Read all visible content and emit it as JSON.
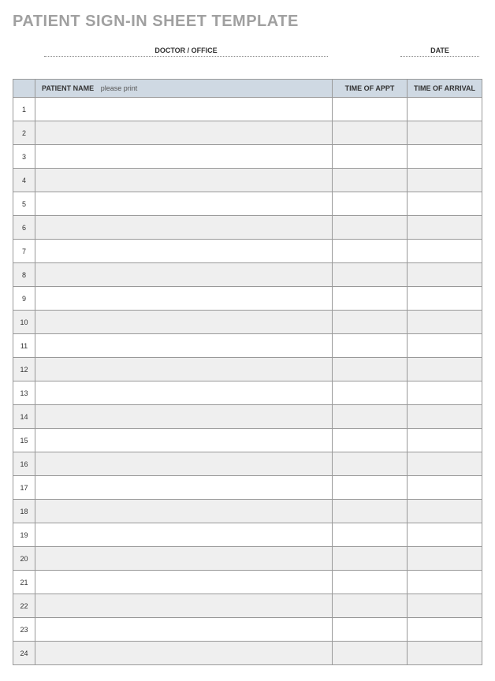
{
  "title": "PATIENT SIGN-IN SHEET TEMPLATE",
  "fields": {
    "doctor_label": "DOCTOR / OFFICE",
    "date_label": "DATE"
  },
  "table": {
    "headers": {
      "patient_name": "PATIENT NAME",
      "patient_name_hint": "please print",
      "time_of_appt": "TIME OF APPT",
      "time_of_arrival": "TIME OF ARRIVAL"
    },
    "rows": [
      {
        "num": "1",
        "name": "",
        "appt": "",
        "arrival": ""
      },
      {
        "num": "2",
        "name": "",
        "appt": "",
        "arrival": ""
      },
      {
        "num": "3",
        "name": "",
        "appt": "",
        "arrival": ""
      },
      {
        "num": "4",
        "name": "",
        "appt": "",
        "arrival": ""
      },
      {
        "num": "5",
        "name": "",
        "appt": "",
        "arrival": ""
      },
      {
        "num": "6",
        "name": "",
        "appt": "",
        "arrival": ""
      },
      {
        "num": "7",
        "name": "",
        "appt": "",
        "arrival": ""
      },
      {
        "num": "8",
        "name": "",
        "appt": "",
        "arrival": ""
      },
      {
        "num": "9",
        "name": "",
        "appt": "",
        "arrival": ""
      },
      {
        "num": "10",
        "name": "",
        "appt": "",
        "arrival": ""
      },
      {
        "num": "11",
        "name": "",
        "appt": "",
        "arrival": ""
      },
      {
        "num": "12",
        "name": "",
        "appt": "",
        "arrival": ""
      },
      {
        "num": "13",
        "name": "",
        "appt": "",
        "arrival": ""
      },
      {
        "num": "14",
        "name": "",
        "appt": "",
        "arrival": ""
      },
      {
        "num": "15",
        "name": "",
        "appt": "",
        "arrival": ""
      },
      {
        "num": "16",
        "name": "",
        "appt": "",
        "arrival": ""
      },
      {
        "num": "17",
        "name": "",
        "appt": "",
        "arrival": ""
      },
      {
        "num": "18",
        "name": "",
        "appt": "",
        "arrival": ""
      },
      {
        "num": "19",
        "name": "",
        "appt": "",
        "arrival": ""
      },
      {
        "num": "20",
        "name": "",
        "appt": "",
        "arrival": ""
      },
      {
        "num": "21",
        "name": "",
        "appt": "",
        "arrival": ""
      },
      {
        "num": "22",
        "name": "",
        "appt": "",
        "arrival": ""
      },
      {
        "num": "23",
        "name": "",
        "appt": "",
        "arrival": ""
      },
      {
        "num": "24",
        "name": "",
        "appt": "",
        "arrival": ""
      }
    ]
  }
}
